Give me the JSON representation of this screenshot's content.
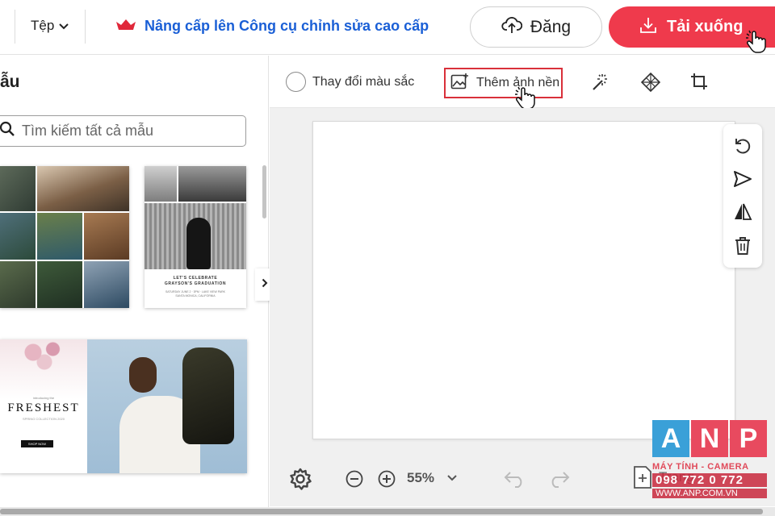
{
  "header": {
    "file_menu_label": "Tệp",
    "upgrade_text": "Nâng cấp lên Công cụ chỉnh sửa cao cấp",
    "share_label": "Đăng",
    "download_label": "Tải xuống"
  },
  "left_panel": {
    "title": "ẫu",
    "search_placeholder": "Tìm kiếm tất cả mẫu",
    "templates": [
      {
        "kind": "collage"
      },
      {
        "kind": "graduation",
        "text_line1": "LET'S CELEBRATE",
        "text_line2": "GRAYSON'S GRADUATION",
        "text_line3": "SATURDAY JUNE 2 · 3PM · LAKE VIEW PARK",
        "text_line4": "SANTA MONICA, CALIFORNIA"
      },
      {
        "kind": "freshest",
        "small_text": "introducing the",
        "title": "FRESHEST",
        "subtitle": "SPRING COLLECTION 2020",
        "button": "SHOP NOW"
      }
    ]
  },
  "toolbar": {
    "change_color_label": "Thay đổi màu sắc",
    "add_background_label": "Thêm ảnh nền",
    "tools": [
      "magic-wand-icon",
      "pattern-icon",
      "crop-icon"
    ]
  },
  "canvas": {
    "side_tools": [
      "rotate-icon",
      "send-icon",
      "flip-icon",
      "delete-icon"
    ]
  },
  "bottom_bar": {
    "zoom_level": "55%",
    "add_page_label": "Trang"
  },
  "watermark": {
    "letters": [
      "A",
      "N",
      "P"
    ],
    "colors": [
      "#3aa0d8",
      "#e84a5f",
      "#e84a5f"
    ],
    "line1": "MÁY TÍNH - CAMERA",
    "line2": "098 772 0 772",
    "line3": "WWW.ANP.COM.VN"
  },
  "colors": {
    "accent": "#ef3a4c",
    "link": "#1a5fd6",
    "highlight_border": "#d9303a"
  }
}
